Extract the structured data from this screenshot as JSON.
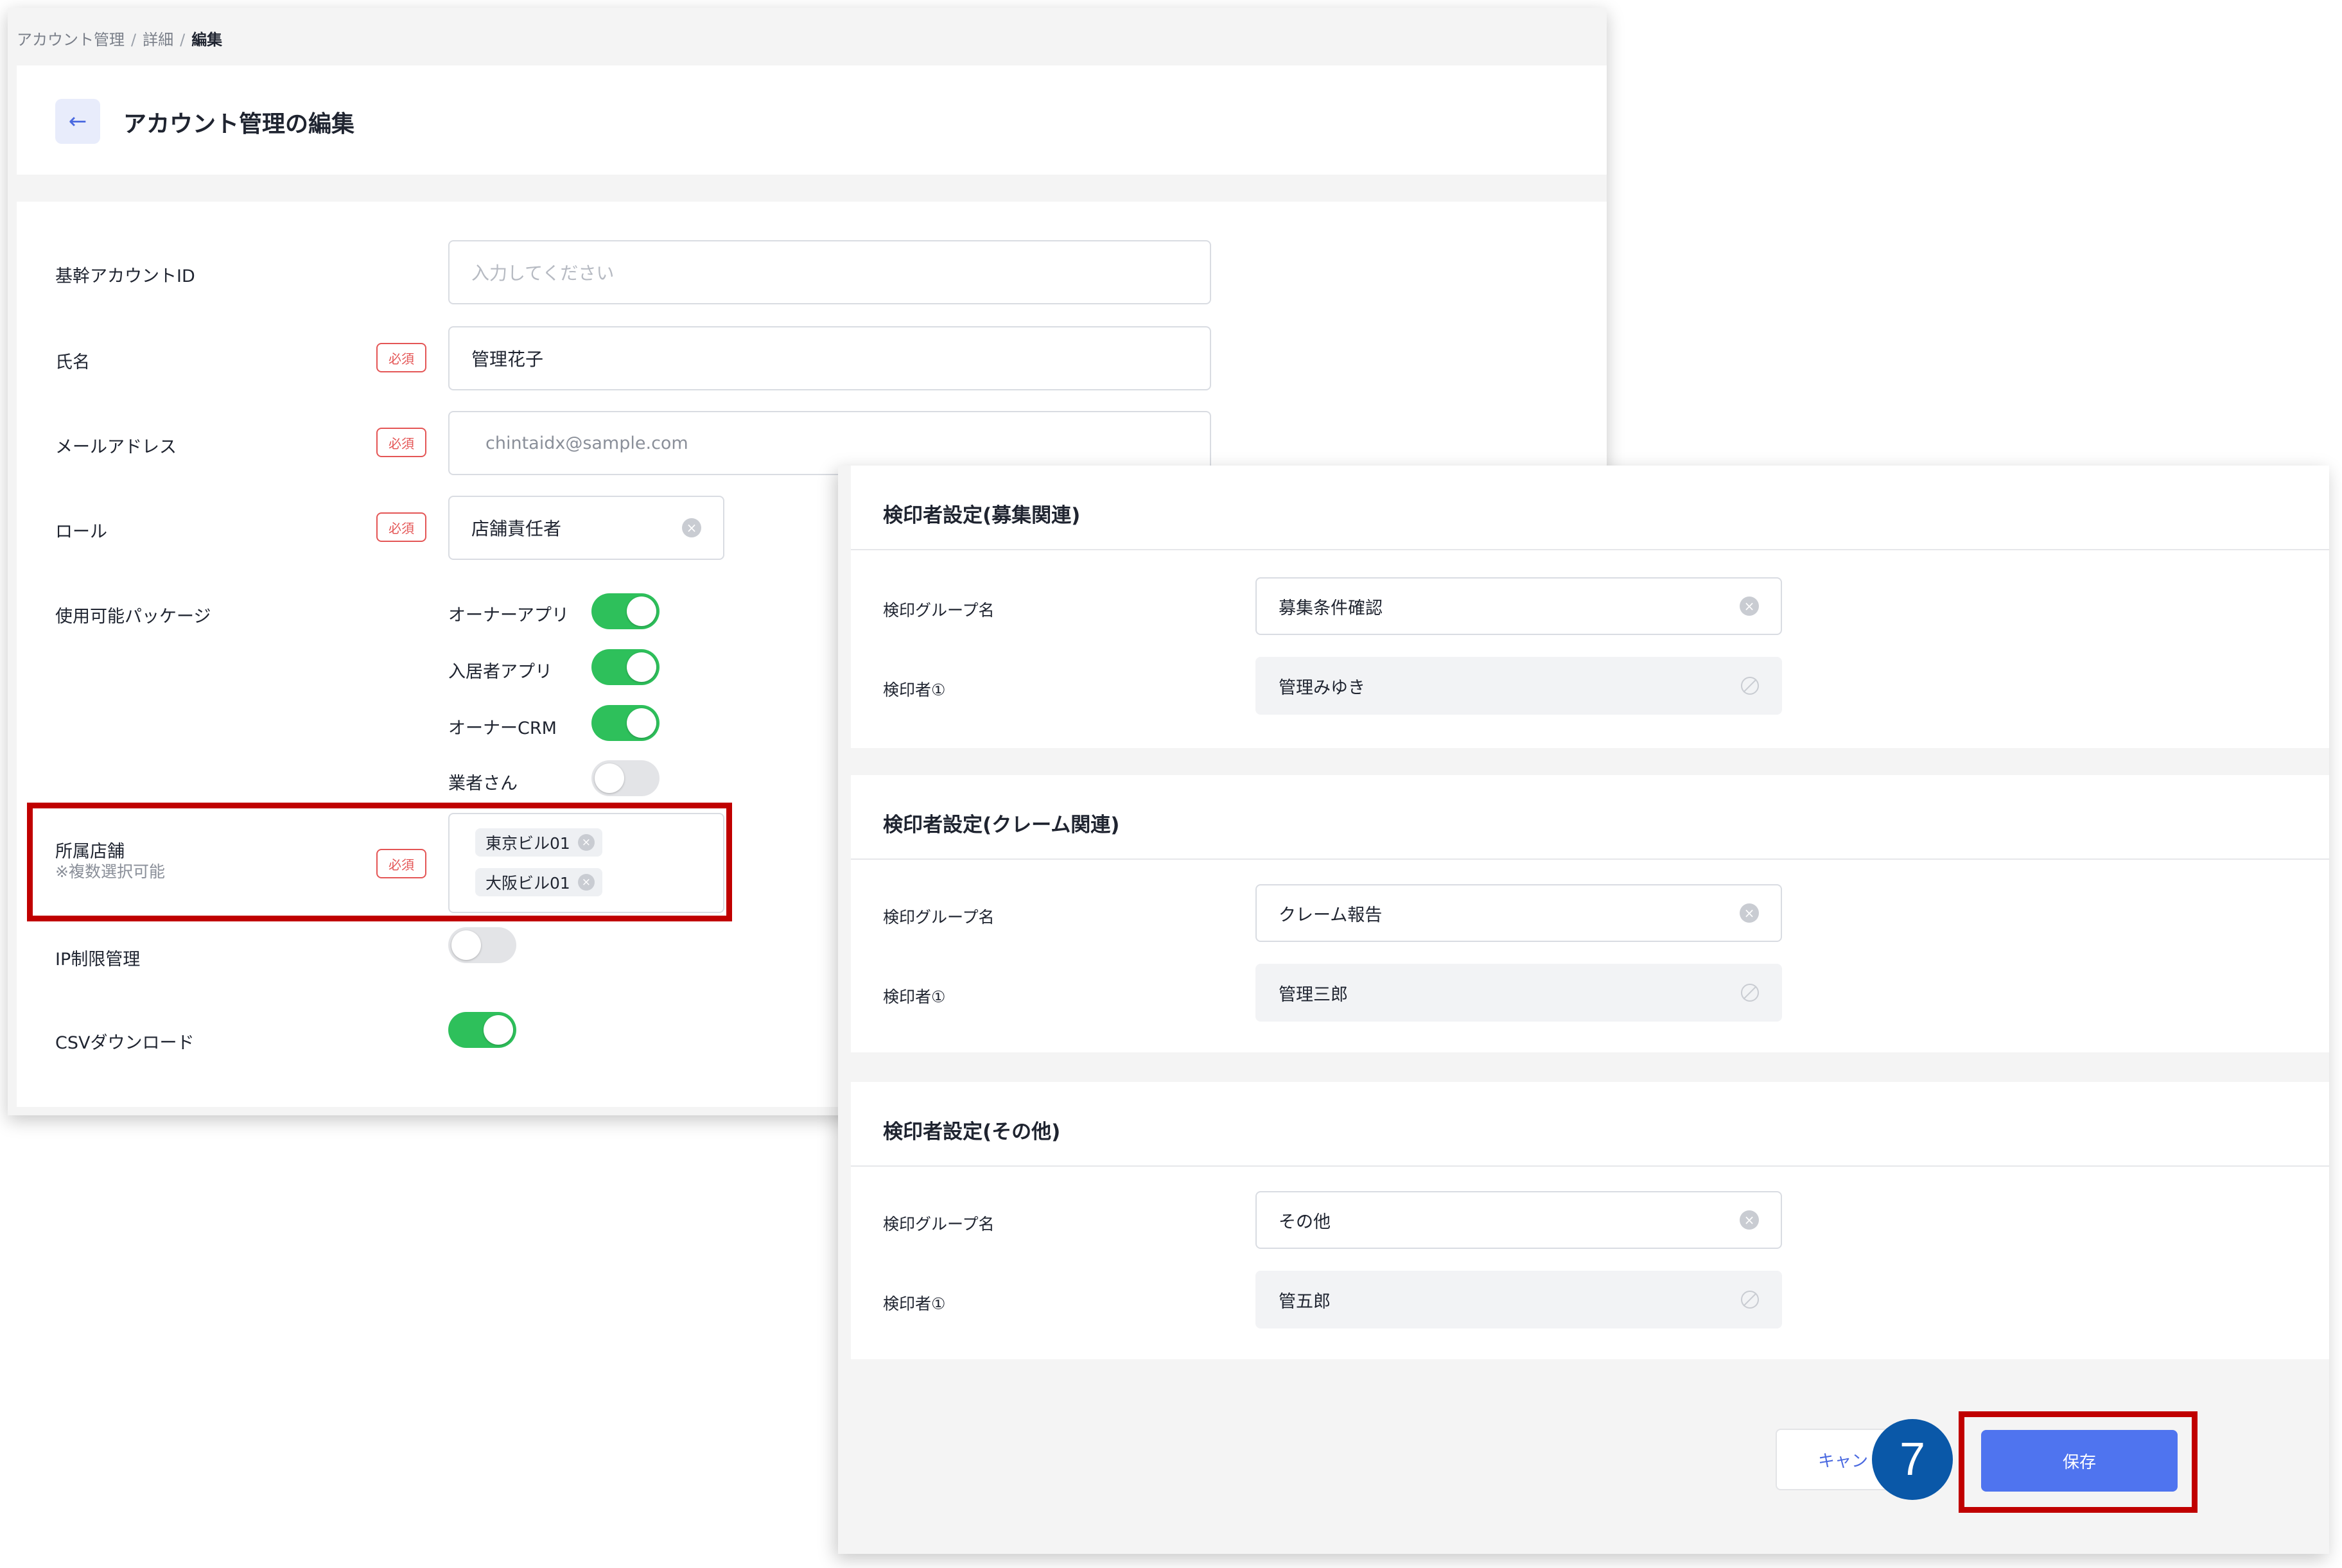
{
  "breadcrumb": {
    "items": [
      "アカウント管理",
      "詳細",
      "編集"
    ],
    "separator": "/"
  },
  "header": {
    "title": "アカウント管理の編集",
    "back_icon": "←"
  },
  "form": {
    "required_label": "必須",
    "clear_icon": "×",
    "base_account_id": {
      "label": "基幹アカウントID",
      "placeholder": "入力してください"
    },
    "name": {
      "label": "氏名",
      "value": "管理花子"
    },
    "email": {
      "label": "メールアドレス",
      "value": "chintaidx@sample.com"
    },
    "role": {
      "label": "ロール",
      "value": "店舗責任者"
    },
    "packages": {
      "label": "使用可能パッケージ",
      "items": [
        {
          "label": "オーナーアプリ",
          "enabled": true
        },
        {
          "label": "入居者アプリ",
          "enabled": true
        },
        {
          "label": "オーナーCRM",
          "enabled": true
        },
        {
          "label": "業者さん",
          "enabled": false
        }
      ]
    },
    "stores": {
      "label": "所属店舗",
      "note": "※複数選択可能",
      "tags": [
        "東京ビル01",
        "大阪ビル01"
      ]
    },
    "ip_restriction": {
      "label": "IP制限管理",
      "enabled": false
    },
    "csv_download": {
      "label": "CSVダウンロード",
      "enabled": true
    }
  },
  "approver_sections": [
    {
      "title": "検印者設定(募集関連)",
      "group_label": "検印グループ名",
      "group_value": "募集条件確認",
      "approver_label": "検印者①",
      "approver_value": "管理みゆき"
    },
    {
      "title": "検印者設定(クレーム関連)",
      "group_label": "検印グループ名",
      "group_value": "クレーム報告",
      "approver_label": "検印者①",
      "approver_value": "管理三郎"
    },
    {
      "title": "検印者設定(その他)",
      "group_label": "検印グループ名",
      "group_value": "その他",
      "approver_label": "検印者①",
      "approver_value": "管五郎"
    }
  ],
  "actions": {
    "cancel_label": "キャン",
    "save_label": "保存"
  },
  "annotation": {
    "step_number": "7",
    "highlight_color": "#c00000",
    "badge_color": "#0a58a8"
  },
  "colors": {
    "accent": "#4f74ef",
    "toggle_on": "#2ec05b",
    "required": "#e45555"
  }
}
